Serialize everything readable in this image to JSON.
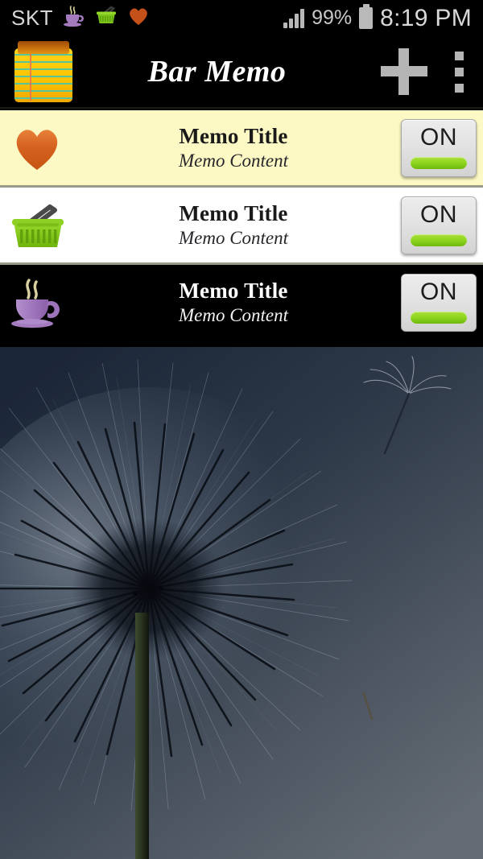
{
  "status_bar": {
    "carrier": "SKT",
    "notification_icons": [
      "coffee-cup-icon",
      "shopping-basket-icon",
      "heart-icon"
    ],
    "signal_icon": "signal-bars-icon",
    "battery_percent": "99%",
    "battery_icon": "battery-full-icon",
    "clock": "8:19 PM"
  },
  "action_bar": {
    "app_icon": "notepad-icon",
    "title": "Bar Memo",
    "add_label": "add-icon",
    "overflow_label": "overflow-menu-icon"
  },
  "memos": [
    {
      "icon": "heart-icon",
      "title": "Memo Title",
      "content": "Memo Content",
      "toggle_label": "ON",
      "toggle_state": "on",
      "theme": "cream",
      "background_color": "#fcf9c4",
      "icon_color": "#d4611e"
    },
    {
      "icon": "shopping-basket-icon",
      "title": "Memo Title",
      "content": "Memo Content",
      "toggle_label": "ON",
      "toggle_state": "on",
      "theme": "white",
      "background_color": "#ffffff",
      "icon_color": "#7cc41c"
    },
    {
      "icon": "coffee-cup-icon",
      "title": "Memo Title",
      "content": "Memo Content",
      "toggle_label": "ON",
      "toggle_state": "on",
      "theme": "black",
      "background_color": "#000000",
      "icon_color": "#a57bc0"
    }
  ],
  "wallpaper": {
    "name": "dandelion-wallpaper",
    "sky_top_color": "#1e2a3d",
    "sky_bottom_color": "#5d646e"
  },
  "colors": {
    "accent_green": "#8ed520",
    "title_bar": "#000000",
    "status_text": "#d6d6d6"
  }
}
